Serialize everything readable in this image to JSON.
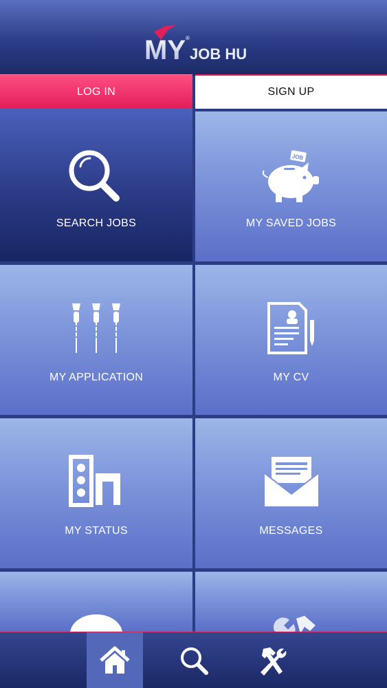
{
  "header": {
    "logo_my": "MY",
    "logo_text": "JOB HUB",
    "logo_tm": "®"
  },
  "auth": {
    "login_label": "LOG IN",
    "signup_label": "SIGN UP"
  },
  "tiles": [
    {
      "label": "SEARCH JOBS",
      "icon": "magnifier-icon",
      "active": true
    },
    {
      "label": "MY SAVED JOBS",
      "icon": "piggy-bank-icon",
      "active": false
    },
    {
      "label": "MY APPLICATION",
      "icon": "darts-icon",
      "active": false
    },
    {
      "label": "MY CV",
      "icon": "document-icon",
      "active": false
    },
    {
      "label": "MY STATUS",
      "icon": "status-icon",
      "active": false
    },
    {
      "label": "MESSAGES",
      "icon": "envelope-icon",
      "active": false
    }
  ],
  "piggy_tag": "JOB",
  "bottom_nav": [
    {
      "icon": "home-icon",
      "active": true
    },
    {
      "icon": "search-icon",
      "active": false
    },
    {
      "icon": "tools-icon",
      "active": false
    }
  ],
  "colors": {
    "accent": "#e21e5b",
    "tile_light": "#9cb6e8",
    "tile_dark": "#2b3b86",
    "header": "#1c2a66"
  }
}
